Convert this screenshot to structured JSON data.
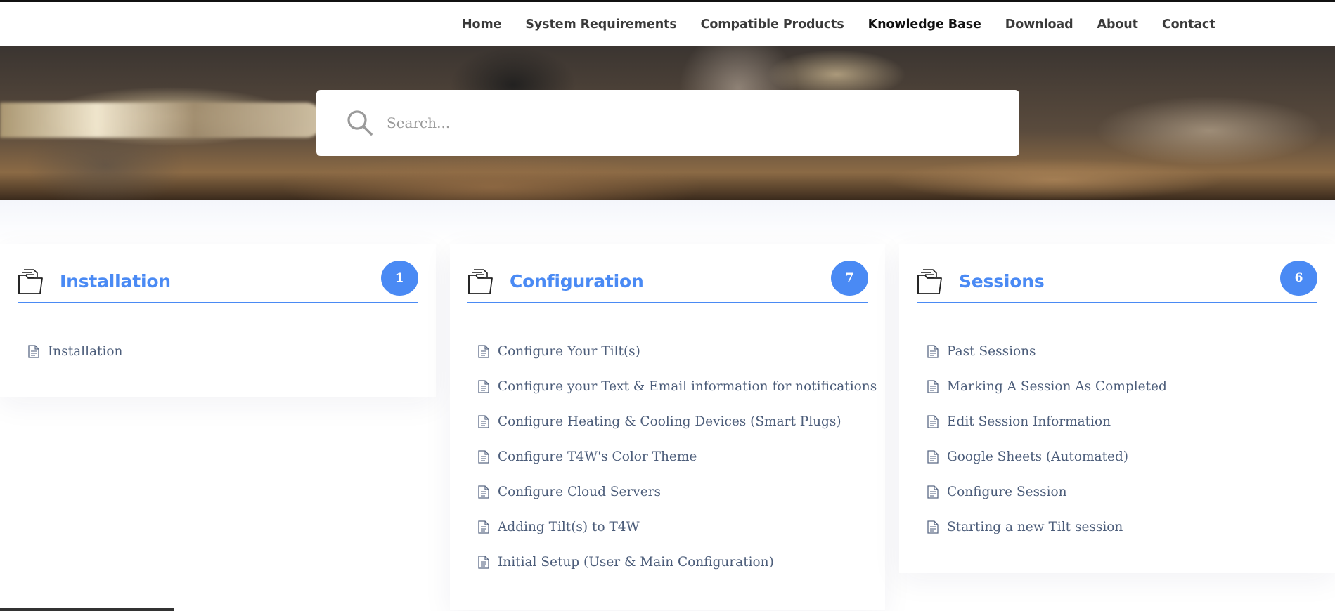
{
  "nav": {
    "items": [
      {
        "label": "Home",
        "active": false
      },
      {
        "label": "System Requirements",
        "active": false
      },
      {
        "label": "Compatible Products",
        "active": false
      },
      {
        "label": "Knowledge Base",
        "active": true
      },
      {
        "label": "Download",
        "active": false
      },
      {
        "label": "About",
        "active": false
      },
      {
        "label": "Contact",
        "active": false
      }
    ]
  },
  "search": {
    "placeholder": "Search...",
    "value": ""
  },
  "categories": [
    {
      "title": "Installation",
      "count": "1",
      "articles": [
        "Installation"
      ]
    },
    {
      "title": "Configuration",
      "count": "7",
      "articles": [
        "Configure Your Tilt(s)",
        "Configure your Text & Email information for notifications",
        "Configure Heating & Cooling Devices (Smart Plugs)",
        "Configure T4W's Color Theme",
        "Configure Cloud Servers",
        "Adding Tilt(s) to T4W",
        "Initial Setup (User & Main Configuration)"
      ]
    },
    {
      "title": "Sessions",
      "count": "6",
      "articles": [
        "Past Sessions",
        "Marking A Session As Completed",
        "Edit Session Information",
        "Google Sheets (Automated)",
        "Configure Session",
        "Starting a new Tilt session"
      ]
    }
  ],
  "colors": {
    "accent": "#4a8af4",
    "link": "#4c5d7a",
    "nav_text": "#3a3a3a"
  },
  "icons": {
    "search": "search-icon",
    "category": "folder-icon",
    "article": "document-icon"
  }
}
